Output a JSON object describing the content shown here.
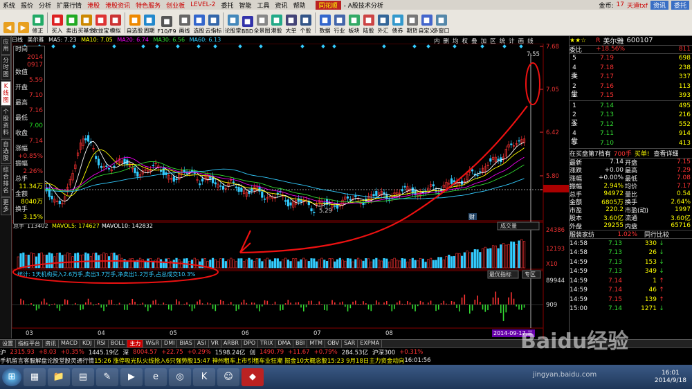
{
  "menubar": {
    "items": [
      "系统",
      "报价",
      "分析",
      "扩展行情"
    ],
    "red_items": [
      "港股",
      "港股资讯",
      "特色服务",
      "创业板",
      "LEVEL-2"
    ],
    "items2": [
      "委托",
      "智能",
      "工具",
      "资讯",
      "帮助"
    ],
    "logo": "同花顺",
    "title": "- A股技术分析",
    "gold_label": "金币:",
    "gold_value": "17",
    "user": "天道txf",
    "btn_news": "资讯",
    "btn_trade": "委托"
  },
  "toolbar": {
    "buttons": [
      "修正",
      "买入",
      "卖出",
      "买基金",
      "收益宝",
      "模拟",
      "自选股",
      "周期",
      "F10/F9",
      "画线",
      "选股",
      "云指标",
      "论股堂",
      "BBD",
      "全景图",
      "港股",
      "大单",
      "个股",
      "数据",
      "行业",
      "板块",
      "陆股",
      "外汇",
      "债券",
      "期货",
      "自定义",
      "多窗口"
    ]
  },
  "leftstrip": {
    "tabs": [
      "应用",
      "分时图",
      "K线图",
      "个股资料",
      "自选股",
      "综合排名",
      "更多"
    ]
  },
  "chart_head": {
    "label": "日线",
    "name": "美尔雅",
    "ma5": "MA5: 7.23",
    "ma10": "MA10: 7.05",
    "ma20": "MA20: 6.74",
    "ma30": "MA30: 6.56",
    "ma60": "MA60: 6.13"
  },
  "period_tabs": [
    "内",
    "删",
    "均",
    "权",
    "叠",
    "加",
    "区",
    "统",
    "计",
    "画",
    "线"
  ],
  "info": {
    "time_label": "时间",
    "date1": "2014",
    "date2": "0917",
    "shu_label": "数值",
    "shu_value": "5.59",
    "open_label": "开盘",
    "open": "7.10",
    "high_label": "最高",
    "high": "7.16",
    "low_label": "最低",
    "low": "7.00",
    "close_label": "收盘",
    "close": "7.14",
    "chg_label": "涨幅",
    "chg": "+0.85%",
    "amp_label": "振幅",
    "amp": "2.26%",
    "vol_label": "总手",
    "vol": "11.34万",
    "amt_label": "金额",
    "amt": "8040万",
    "turn_label": "换手",
    "turn": "3.15%"
  },
  "price_axis": [
    "7.68",
    "7.05",
    "6.42",
    "5.80",
    "5.59"
  ],
  "annot": {
    "high_mark": "7.55",
    "low_mark": "5.29",
    "cai": "财"
  },
  "volume_head": {
    "label": "总手",
    "v1": "113402",
    "mavol5": "MAVOL5: 174627",
    "mavol10": "MAVOL10: 142832",
    "dropdown": "成交量"
  },
  "vol_axis": [
    "24386",
    "12193",
    "X10"
  ],
  "ind_text": "统计: 1天机构买入2.6万手,卖出3.7万手,净卖出1.2万手,占总成交10.3%",
  "ind_tabs": [
    "最优指标",
    "专区"
  ],
  "ind_axis": [
    "89944",
    "909"
  ],
  "months": [
    "03",
    "04",
    "05",
    "06",
    "07",
    "08"
  ],
  "date_badge": "2014-09-17,三",
  "rp": {
    "stars": "★★☆",
    "code_r": "R",
    "stock_name": "美尔雅",
    "code": "600107",
    "wb_label": "委比",
    "wb_value": "+18.56%",
    "wb_right": "811",
    "sell_label": [
      "卖",
      "盘"
    ],
    "buy_label": [
      "买",
      "盘"
    ],
    "sells": [
      {
        "n": "5",
        "p": "7.19",
        "v": "698"
      },
      {
        "n": "4",
        "p": "7.18",
        "v": "238"
      },
      {
        "n": "3",
        "p": "7.17",
        "v": "337"
      },
      {
        "n": "2",
        "p": "7.16",
        "v": "113"
      },
      {
        "n": "1",
        "p": "7.15",
        "v": "393"
      }
    ],
    "buys": [
      {
        "n": "1",
        "p": "7.14",
        "v": "495"
      },
      {
        "n": "2",
        "p": "7.13",
        "v": "216"
      },
      {
        "n": "3",
        "p": "7.12",
        "v": "552"
      },
      {
        "n": "4",
        "p": "7.11",
        "v": "914"
      },
      {
        "n": "5",
        "p": "7.10",
        "v": "413"
      }
    ],
    "rank": "在买盘第7档有",
    "rank_v": "700手",
    "rank_btn1": "买单!",
    "rank_btn2": "查看详细",
    "stats": [
      {
        "l": "最新",
        "v": "7.14",
        "l2": "开盘",
        "v2": "7.15"
      },
      {
        "l": "涨跌",
        "v": "+0.00",
        "l2": "最高",
        "v2": "7.29"
      },
      {
        "l": "涨幅",
        "v": "+0.00%",
        "l2": "最低",
        "v2": "7.08"
      },
      {
        "l": "振幅",
        "v": "2.94%",
        "l2": "均价",
        "v2": "7.17"
      },
      {
        "l": "总手",
        "v": "94972",
        "l2": "量比",
        "v2": "0.54"
      },
      {
        "l": "金额",
        "v": "6805万",
        "l2": "换手",
        "v2": "2.64%"
      },
      {
        "l": "市盈",
        "v": "220.2",
        "l2": "市盈(动)",
        "v2": "1997"
      },
      {
        "l": "股本",
        "v": "3.60亿",
        "l2": "流通",
        "v2": "3.60亿"
      },
      {
        "l": "外盘",
        "v": "29255",
        "l2": "内盘",
        "v2": "65716"
      }
    ],
    "news": "服装家纺",
    "news_v": "1.02%",
    "news_btn": "同行比较",
    "ticks": [
      {
        "t": "14:58",
        "p": "7.13",
        "v": "330",
        "a": "↓"
      },
      {
        "t": "14:58",
        "p": "7.13",
        "v": "26",
        "a": "↓"
      },
      {
        "t": "14:59",
        "p": "7.13",
        "v": "153",
        "a": "↓"
      },
      {
        "t": "14:59",
        "p": "7.13",
        "v": "349",
        "a": "↓"
      },
      {
        "t": "14:59",
        "p": "7.14",
        "v": "1",
        "a": "↑"
      },
      {
        "t": "14:59",
        "p": "7.14",
        "v": "46",
        "a": "↑"
      },
      {
        "t": "14:59",
        "p": "7.15",
        "v": "139",
        "a": "↑"
      },
      {
        "t": "15:00",
        "p": "7.14",
        "v": "1271",
        "a": "↓"
      }
    ]
  },
  "bottom_tabs": [
    "设置",
    "指标平台",
    "资讯",
    "MACD",
    "KDJ",
    "RSI",
    "BOLL",
    "主力",
    "W&R",
    "DMI",
    "BIAS",
    "ASI",
    "VR",
    "ARBR",
    "DPO",
    "TRIX",
    "DMA",
    "BBI",
    "MTM",
    "OBV",
    "SAR",
    "EXPMA"
  ],
  "status": [
    {
      "t": "沪",
      "c": "wht"
    },
    {
      "t": "2315.93",
      "c": "red"
    },
    {
      "t": "+8.03",
      "c": "red"
    },
    {
      "t": "+0.35%",
      "c": "red"
    },
    {
      "t": "1445.19亿",
      "c": "wht"
    },
    {
      "t": "深",
      "c": "wht"
    },
    {
      "t": "8004.57",
      "c": "red"
    },
    {
      "t": "+22.75",
      "c": "red"
    },
    {
      "t": "+0.29%",
      "c": "red"
    },
    {
      "t": "1598.24亿",
      "c": "wht"
    },
    {
      "t": "创",
      "c": "wht"
    },
    {
      "t": "1490.79",
      "c": "red"
    },
    {
      "t": "+11.67",
      "c": "red"
    },
    {
      "t": "+0.79%",
      "c": "red"
    },
    {
      "t": "284.53亿",
      "c": "wht"
    },
    {
      "t": "沪深300",
      "c": "wht"
    },
    {
      "t": "+0.31%",
      "c": "red"
    }
  ],
  "newsbar": [
    {
      "t": "手机",
      "c": "wht"
    },
    {
      "t": "留言",
      "c": "wht"
    },
    {
      "t": "客服",
      "c": "wht"
    },
    {
      "t": "解盘",
      "c": "wht"
    },
    {
      "t": "论股堂",
      "c": "wht"
    },
    {
      "t": "股灵通",
      "c": "wht"
    },
    {
      "t": "行情",
      "c": "wht"
    },
    {
      "t": "15:26 涨停吸光队火线抢入6只强势股",
      "c": "yel"
    },
    {
      "t": "15:47 神州租车上市引租车业狂潮 掘金10大概念股",
      "c": "yel"
    },
    {
      "t": "15:23 9月18日主力资金动向",
      "c": "yel"
    },
    {
      "t": "16:01:56",
      "c": "wht"
    }
  ],
  "clock": {
    "time": "16:01",
    "date": "2014/9/18"
  },
  "watermark": "Baidu经验",
  "wm_url": "jingyan.baidu.com"
}
